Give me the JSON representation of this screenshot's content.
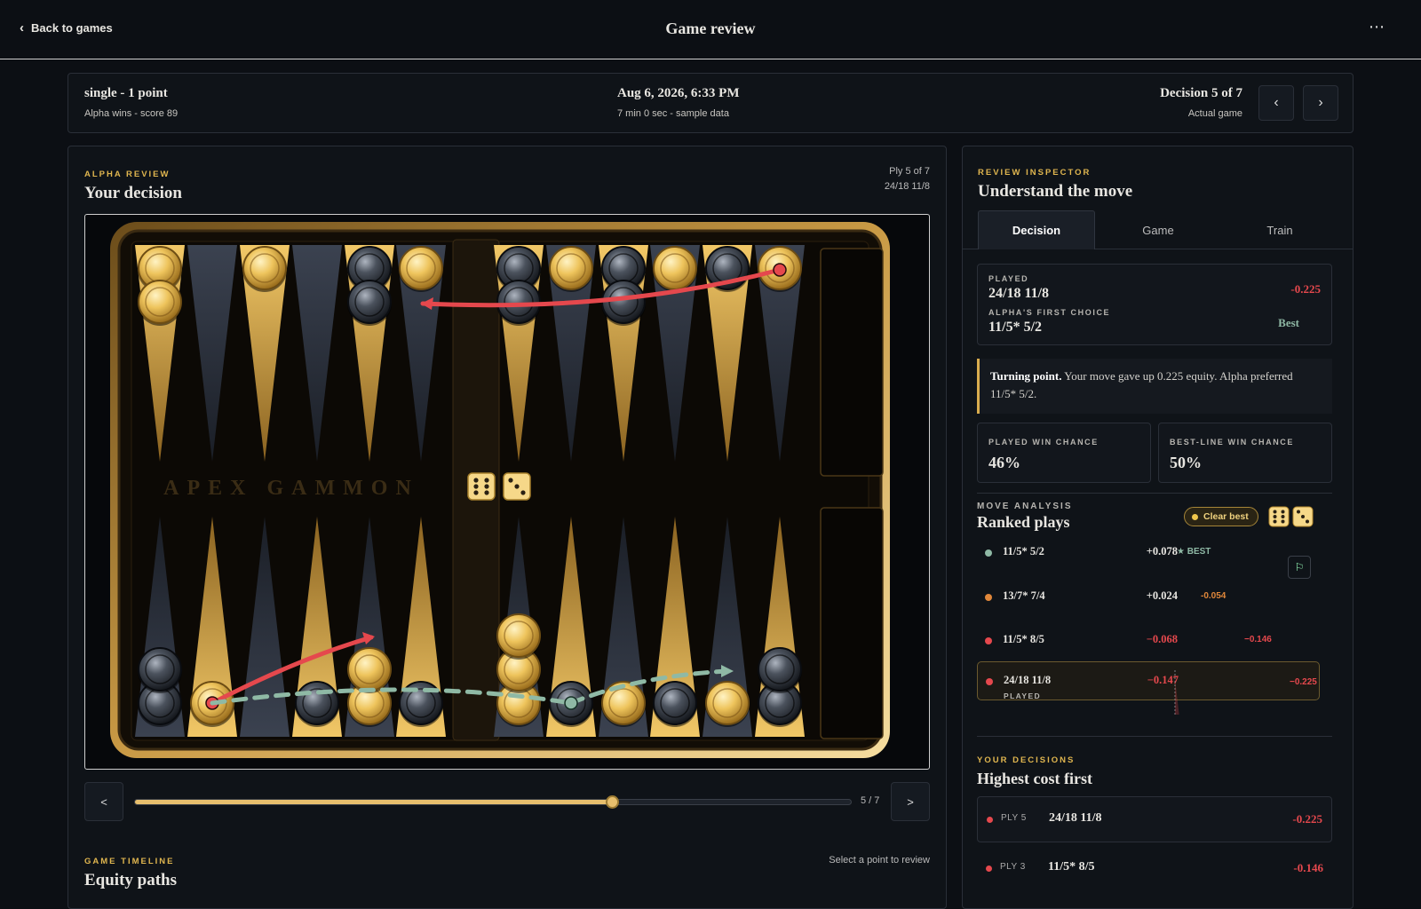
{
  "header": {
    "back_label": "Back to games",
    "title": "Game review",
    "more_label": "⋯"
  },
  "summary": {
    "match_type": "single - 1 point",
    "result": "Alpha wins - score 89",
    "date": "Aug 6, 2026, 6:33 PM",
    "duration": "7 min 0 sec - sample data",
    "decision": "Decision 5 of 7",
    "mode": "Actual game",
    "prev_label": "‹",
    "next_label": "›"
  },
  "review": {
    "eyebrow": "ALPHA REVIEW",
    "title": "Your decision",
    "ply": "Ply 5 of 7",
    "move": "24/18 11/8",
    "board_watermark": "APEX GAMMON",
    "dice": [
      6,
      3
    ]
  },
  "scrubber": {
    "prev_label": "<",
    "next_label": ">",
    "count": "5 / 7",
    "progress": 0.6667
  },
  "timeline": {
    "eyebrow": "GAME TIMELINE",
    "title": "Equity paths",
    "hint": "Select a point to review"
  },
  "inspector": {
    "eyebrow": "REVIEW INSPECTOR",
    "title": "Understand the move",
    "tabs": [
      {
        "label": "Decision",
        "active": true
      },
      {
        "label": "Game",
        "active": false
      },
      {
        "label": "Train",
        "active": false
      }
    ],
    "played_label": "PLAYED",
    "played_move": "24/18 11/8",
    "played_equity": "-0.225",
    "first_choice_label": "ALPHA'S FIRST CHOICE",
    "first_choice_move": "11/5* 5/2",
    "first_choice_tag": "Best",
    "turning_bold": "Turning point.",
    "turning_text": " Your move gave up 0.225 equity. Alpha preferred 11/5* 5/2.",
    "played_win_label": "PLAYED WIN CHANCE",
    "played_win": "46%",
    "best_win_label": "BEST-LINE WIN CHANCE",
    "best_win": "50%"
  },
  "move_analysis": {
    "eyebrow": "MOVE ANALYSIS",
    "title": "Ranked plays",
    "clear_best": "Clear best",
    "plays": [
      {
        "move": "11/5* 5/2",
        "equity": "+0.078",
        "note": "★ BEST",
        "color": "#8fb9a5",
        "delta": 0,
        "played": false
      },
      {
        "move": "13/7* 7/4",
        "equity": "+0.024",
        "note": "-0.054",
        "color": "#e0873a",
        "delta": -0.054,
        "played": false
      },
      {
        "move": "11/5* 8/5",
        "equity": "−0.068",
        "note": "−0.146",
        "color": "#e5484d",
        "delta": -0.146,
        "played": false
      },
      {
        "move": "24/18 11/8",
        "equity": "−0.147",
        "note": "−0.225",
        "color": "#e5484d",
        "delta": -0.225,
        "played": true,
        "sub": "PLAYED"
      }
    ]
  },
  "your_decisions": {
    "eyebrow": "YOUR DECISIONS",
    "title": "Highest cost first",
    "rows": [
      {
        "ply": "PLY 5",
        "move": "24/18 11/8",
        "equity": "-0.225"
      },
      {
        "ply": "PLY 3",
        "move": "11/5* 8/5",
        "equity": "-0.146"
      }
    ]
  },
  "colors": {
    "accent_gold": "#e0b64f",
    "negative": "#e5484d",
    "best": "#8fb9a5"
  }
}
